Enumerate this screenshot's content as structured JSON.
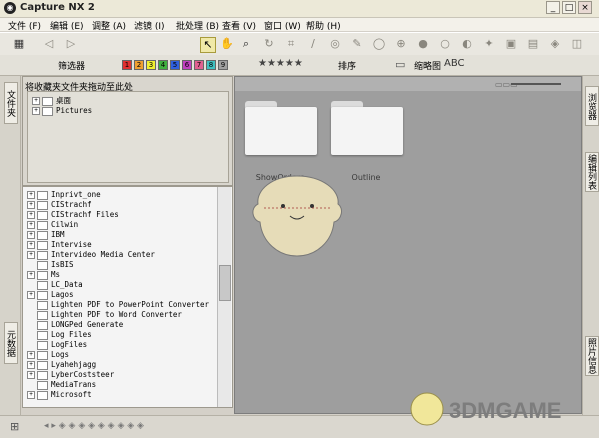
{
  "window": {
    "title": "Capture NX 2",
    "app_icon": "camera-icon"
  },
  "menu": [
    {
      "label": "文件 (F)"
    },
    {
      "label": "编辑 (E)"
    },
    {
      "label": "调整 (A)"
    },
    {
      "label": "滤镜 (I)"
    },
    {
      "label": "批处理 (B)"
    },
    {
      "label": "查看 (V)"
    },
    {
      "label": "窗口 (W)"
    },
    {
      "label": "帮助 (H)"
    }
  ],
  "toolbar2": {
    "filter_label": "筛选器",
    "sort_label": "排序",
    "view_label": "缩略图",
    "stars": "★★★★★",
    "swatch_colors": [
      "#e03030",
      "#f0a030",
      "#f0f030",
      "#40b040",
      "#3060e0",
      "#c040c0",
      "#e06090",
      "#40c0c0",
      "#a0a0a0"
    ],
    "swatch_labels": [
      "1",
      "2",
      "3",
      "4",
      "5",
      "6",
      "7",
      "8",
      "9"
    ]
  },
  "left_tabs": [
    "文件夹",
    "元数据"
  ],
  "right_tabs": [
    "浏览器",
    "编辑列表",
    "照片信息"
  ],
  "folder_pane": {
    "header": "将收藏夹文件夹拖动至此处",
    "items": [
      "桌面",
      "Pictures"
    ]
  },
  "tree": {
    "items": [
      {
        "label": "Inprivt_one",
        "expandable": true
      },
      {
        "label": "CIStrachf",
        "expandable": true
      },
      {
        "label": "CIStrachf Files",
        "expandable": true
      },
      {
        "label": "Cilwin",
        "expandable": true
      },
      {
        "label": "IBM",
        "expandable": true
      },
      {
        "label": "Intervise",
        "expandable": true
      },
      {
        "label": "Intervideo Media Center",
        "expandable": true
      },
      {
        "label": "IsBIS",
        "expandable": false
      },
      {
        "label": "Ms",
        "expandable": true
      },
      {
        "label": "LC_Data",
        "expandable": false
      },
      {
        "label": "Lagos",
        "expandable": true
      },
      {
        "label": "Lighten PDF to PowerPoint Converter",
        "expandable": false
      },
      {
        "label": "Lighten PDF to Word Converter",
        "expandable": false
      },
      {
        "label": "LONGPed Generate",
        "expandable": false
      },
      {
        "label": "Log Files",
        "expandable": false
      },
      {
        "label": "LogFiles",
        "expandable": false
      },
      {
        "label": "Logs",
        "expandable": true
      },
      {
        "label": "Lyahehjagg",
        "expandable": true
      },
      {
        "label": "LyberCoststeer",
        "expandable": true
      },
      {
        "label": "MediaTrans",
        "expandable": false
      },
      {
        "label": "Microsoft",
        "expandable": true
      }
    ]
  },
  "browser": {
    "folders": [
      {
        "label": "ShowOrders"
      },
      {
        "label": "Outline"
      }
    ]
  },
  "watermark": {
    "text": "3DMGAME"
  },
  "colors": {
    "browser_bg": "#9e9e9e",
    "folder_white": "#f4f4f4",
    "watermark": "#7d7d7d"
  }
}
